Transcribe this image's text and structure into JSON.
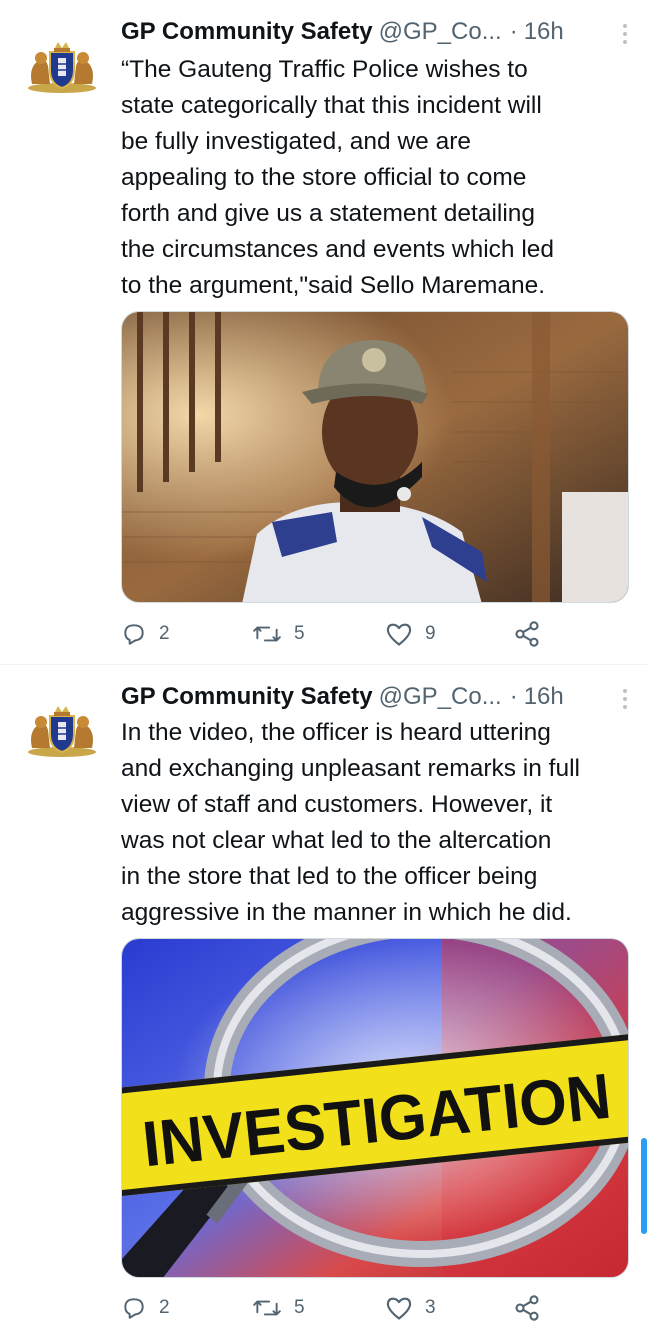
{
  "tweets": [
    {
      "author_name": "GP Community Safety",
      "author_handle": "@GP_Co...",
      "separator": "·",
      "time": "16h",
      "text": "“The Gauteng Traffic Police wishes to\nstate categorically that this incident will\nbe fully investigated, and we are\nappealing to the store official to come\nforth and give us a statement detailing\nthe circumstances and events which led\nto the argument,\"said Sello Maremane.",
      "media_icon": "officer-photo",
      "replies": "2",
      "retweets": "5",
      "likes": "9"
    },
    {
      "author_name": "GP Community Safety",
      "author_handle": "@GP_Co...",
      "separator": "·",
      "time": "16h",
      "text": "In the video, the officer is heard uttering\nand exchanging unpleasant remarks in full\nview of staff and customers.  However, it\nwas not clear what led to the altercation\nin the store that led to the officer being\naggressive in the manner in which he did.",
      "media_caption": "INVESTIGATION",
      "replies": "2",
      "retweets": "5",
      "likes": "3"
    }
  ],
  "icons": {
    "reply": "reply-icon",
    "retweet": "retweet-icon",
    "like": "heart-icon",
    "share": "share-icon",
    "more": "more-icon",
    "avatar": "coat-of-arms-icon"
  },
  "colors": {
    "text": "#0f1419",
    "muted": "#536471",
    "border": "#cfd9de",
    "scrollbar": "#2a9df4",
    "tape_yellow": "#f2e11a"
  }
}
